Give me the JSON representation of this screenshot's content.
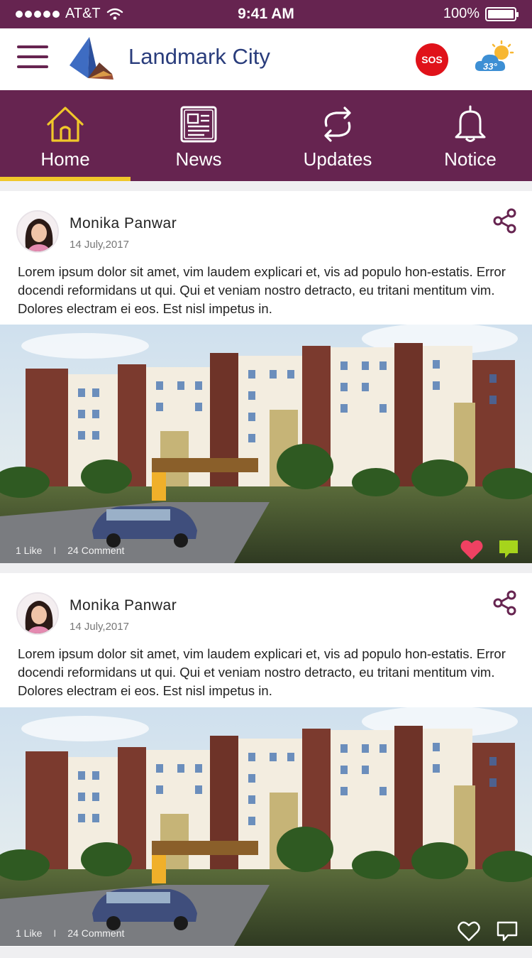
{
  "status_bar": {
    "carrier": "AT&T",
    "time": "9:41 AM",
    "battery": "100%"
  },
  "header": {
    "title": "Landmark City",
    "sos_label": "SOS",
    "temperature": "33°"
  },
  "nav": {
    "tabs": [
      {
        "label": "Home",
        "icon": "home-icon",
        "active": true
      },
      {
        "label": "News",
        "icon": "newspaper-icon",
        "active": false
      },
      {
        "label": "Updates",
        "icon": "refresh-icon",
        "active": false
      },
      {
        "label": "Notice",
        "icon": "bell-icon",
        "active": false
      }
    ]
  },
  "posts": [
    {
      "author": "Monika Panwar",
      "date": "14 July,2017",
      "text": "Lorem ipsum dolor sit amet, vim laudem explicari et, vis ad populo hon-estatis. Error docendi reformidans ut qui. Qui et veniam nostro detracto, eu tritani mentitum vim. Dolores electram ei eos. Est nisl impetus in.",
      "likes": "1 Like",
      "comments": "24 Comment",
      "liked": true
    },
    {
      "author": "Monika Panwar",
      "date": "14 July,2017",
      "text": "Lorem ipsum dolor sit amet, vim laudem explicari et, vis ad populo hon-estatis. Error docendi reformidans ut qui. Qui et veniam nostro detracto, eu tritani mentitum vim. Dolores electram ei eos. Est nisl impetus in.",
      "likes": "1 Like",
      "comments": "24 Comment",
      "liked": false
    }
  ],
  "colors": {
    "primary": "#662450",
    "accent": "#f0c72a",
    "title": "#2a3d7c",
    "sos": "#e0121a",
    "like": "#ef4162",
    "comment": "#a6d41c"
  }
}
